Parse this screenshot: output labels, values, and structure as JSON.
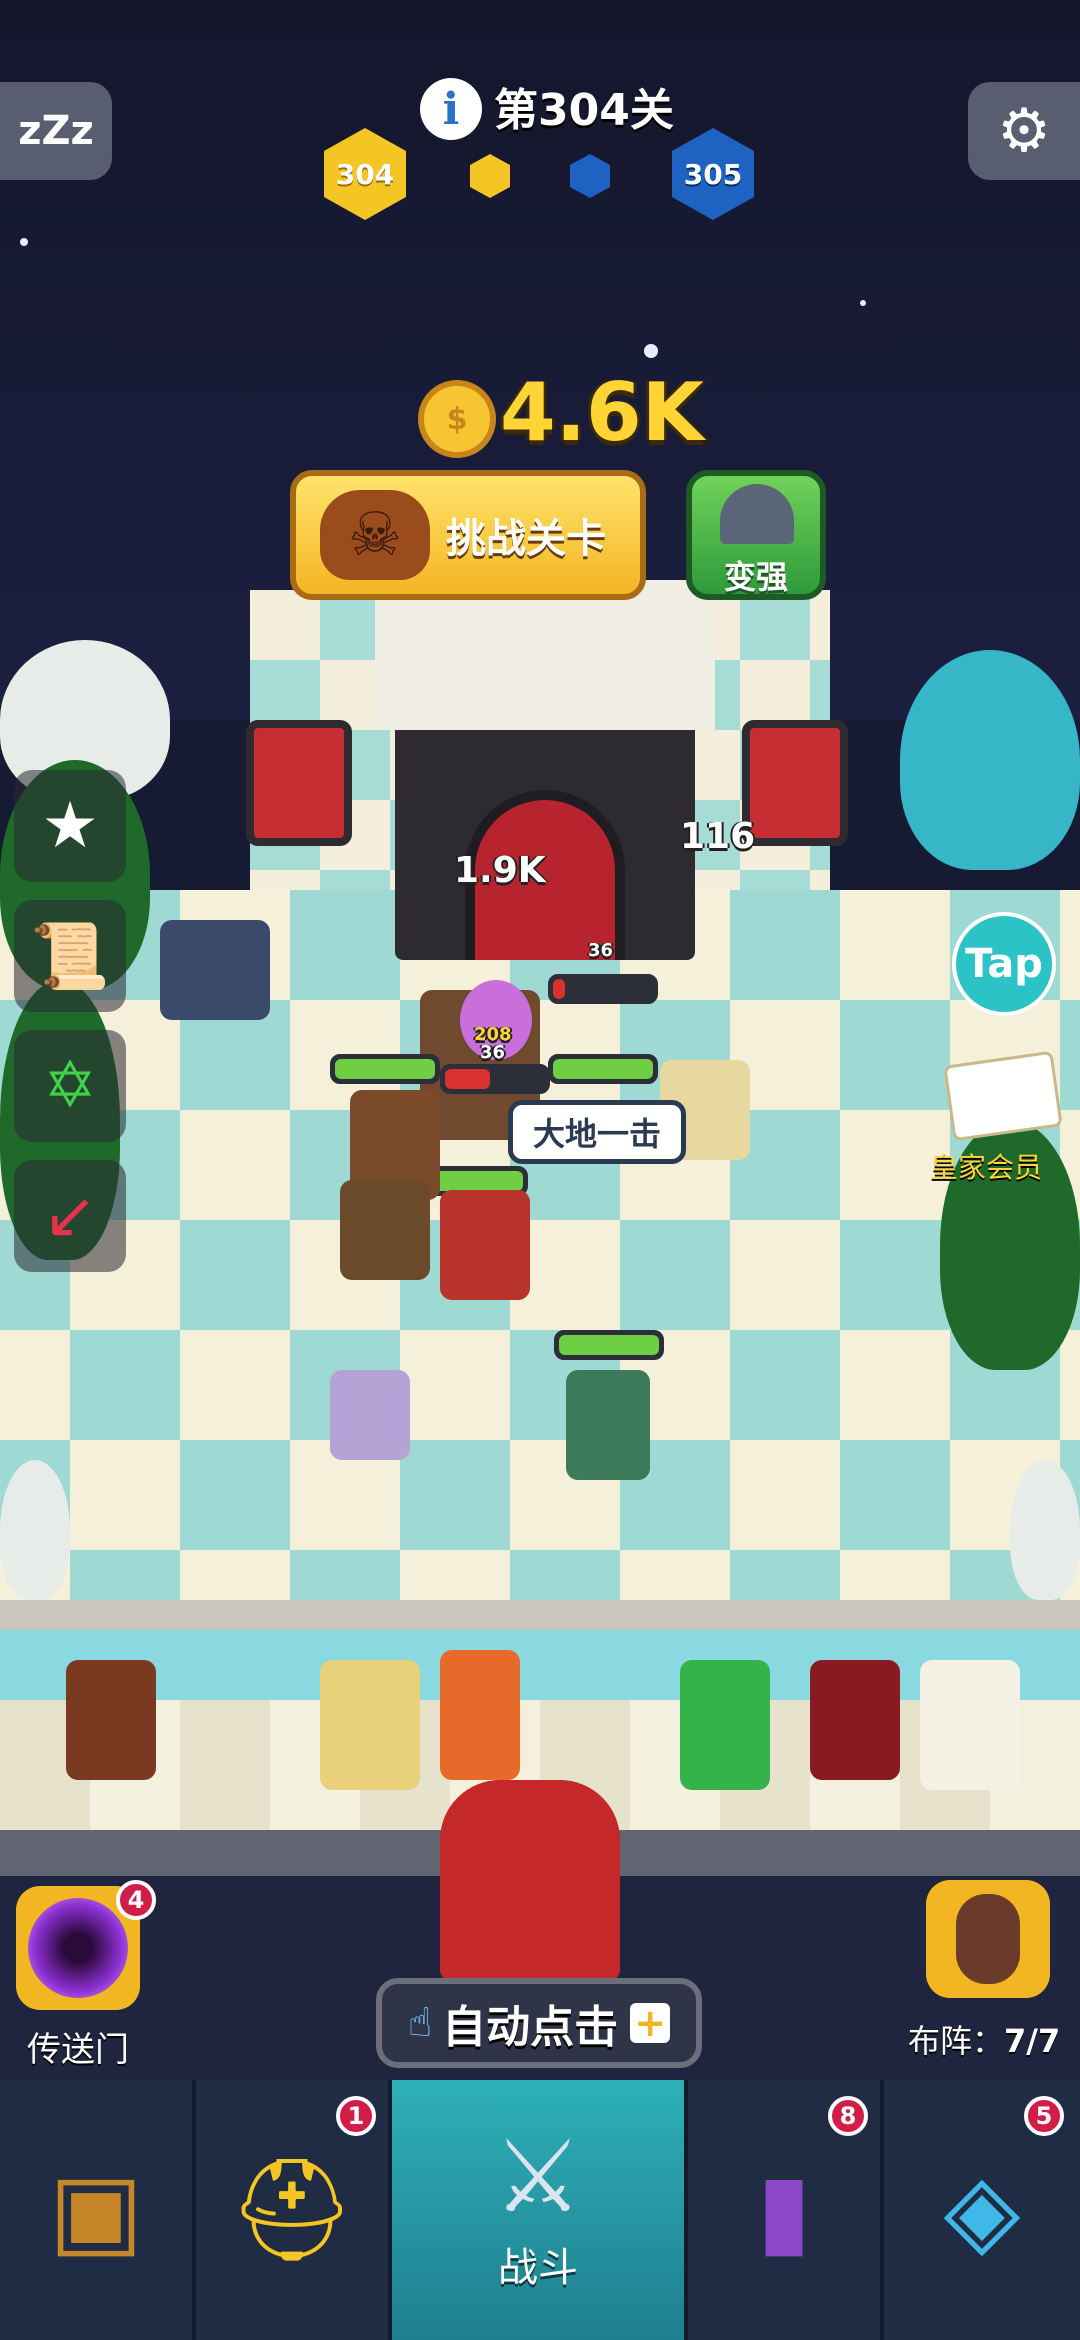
{
  "hud": {
    "level_title": "第304关",
    "current_level": "304",
    "next_level": "305",
    "sleep_label": "zZz",
    "settings_icon": "gear-icon"
  },
  "gold": {
    "amount": "4.6K",
    "coin_icon": "coin-icon"
  },
  "actions": {
    "challenge_label": "挑战关卡",
    "powerup_label": "变强"
  },
  "board": {
    "drop_left": "1.9K",
    "drop_right": "116",
    "damage_top": "36",
    "damage_a": "208",
    "damage_b": "36",
    "skill_text": "大地一击"
  },
  "side": {
    "tap_label": "Tap",
    "vip_label": "皇家会员"
  },
  "bottom": {
    "portal_label": "传送门",
    "portal_badge": "4",
    "auto_label": "自动点击",
    "formation_label": "布阵：",
    "formation_value": "7/7"
  },
  "nav": {
    "tabs": [
      {
        "icon": "treasure-chest-icon",
        "badge": ""
      },
      {
        "icon": "winged-helmet-icon",
        "badge": "1"
      },
      {
        "icon": "crossed-swords-icon",
        "label": "战斗",
        "badge": ""
      },
      {
        "icon": "spellbook-icon",
        "badge": "8"
      },
      {
        "icon": "amulet-icon",
        "badge": "5"
      }
    ]
  },
  "colors": {
    "level_current": "#f3c623",
    "level_next": "#1f63c2",
    "gold_text": "#ffd536",
    "nav_active": "#2eb0b8"
  }
}
